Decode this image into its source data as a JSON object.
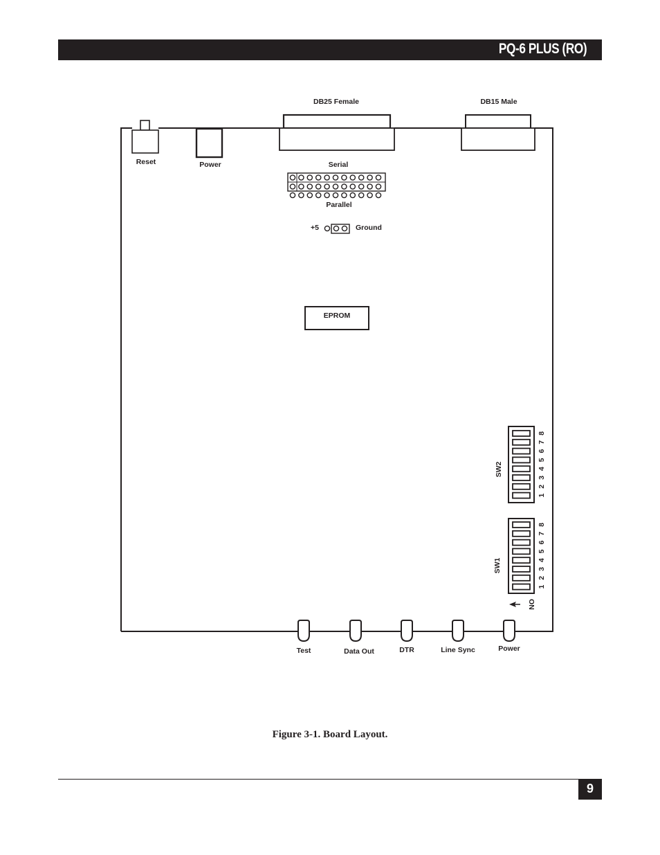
{
  "header": {
    "title": "PQ-6 PLUS (RO)"
  },
  "figure": {
    "caption": "Figure 3-1. Board Layout.",
    "connectors": {
      "db25": "DB25 Female",
      "db15": "DB15 Male"
    },
    "top_components": {
      "reset": "Reset",
      "power_jack": "Power"
    },
    "headers": {
      "serial": "Serial",
      "parallel": "Parallel",
      "serial_pin_columns": 11,
      "parallel_pin_columns": 11
    },
    "jumper": {
      "left_label": "+5",
      "right_label": "Ground"
    },
    "eprom": "EPROM",
    "switches": [
      {
        "name": "SW2",
        "positions": [
          "1",
          "2",
          "3",
          "4",
          "5",
          "6",
          "7",
          "8"
        ]
      },
      {
        "name": "SW1",
        "positions": [
          "1",
          "2",
          "3",
          "4",
          "5",
          "6",
          "7",
          "8"
        ],
        "on_label": "ON"
      }
    ],
    "leds": [
      "Test",
      "Data Out",
      "DTR",
      "Line Sync",
      "Power"
    ]
  },
  "footer": {
    "page_number": "9"
  }
}
